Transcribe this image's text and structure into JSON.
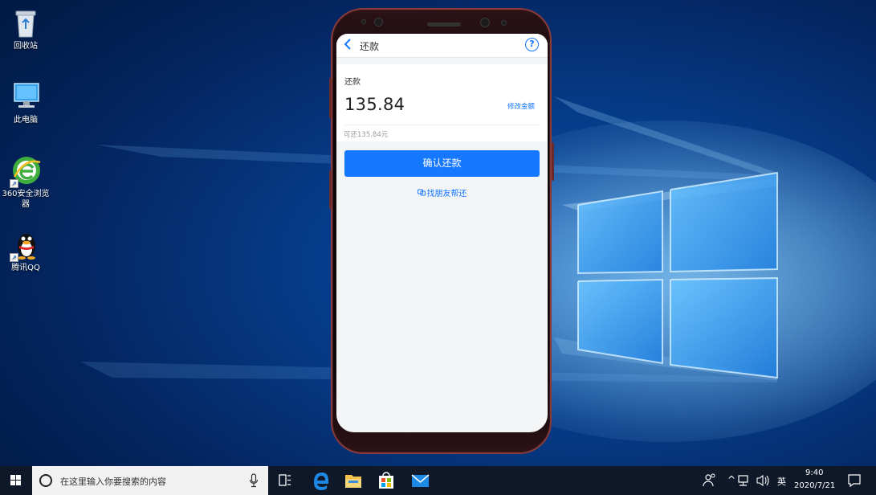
{
  "desktop": {
    "icons": [
      {
        "label": "回收站"
      },
      {
        "label": "此电脑"
      },
      {
        "label": "360安全浏览器"
      },
      {
        "label": "腾讯QQ"
      }
    ]
  },
  "phone_app": {
    "nav": {
      "back_icon": "chevron-left-icon",
      "title": "还款",
      "help_icon": "question-circle-icon",
      "help_glyph": "?"
    },
    "repay": {
      "section_label": "还款",
      "amount": "135.84",
      "modify_label": "修改金额",
      "available_text": "可还135.84元"
    },
    "confirm_button": "确认还款",
    "friend_link": "找朋友帮还",
    "colors": {
      "accent": "#1677ff",
      "background": "#f4f5f7"
    }
  },
  "taskbar": {
    "search_placeholder": "在这里输入你要搜索的内容",
    "pinned": [
      "task-view-icon",
      "edge-icon",
      "file-explorer-icon",
      "store-icon",
      "mail-icon"
    ],
    "tray": {
      "ime": "英",
      "time": "9:40",
      "date": "2020/7/21"
    }
  }
}
